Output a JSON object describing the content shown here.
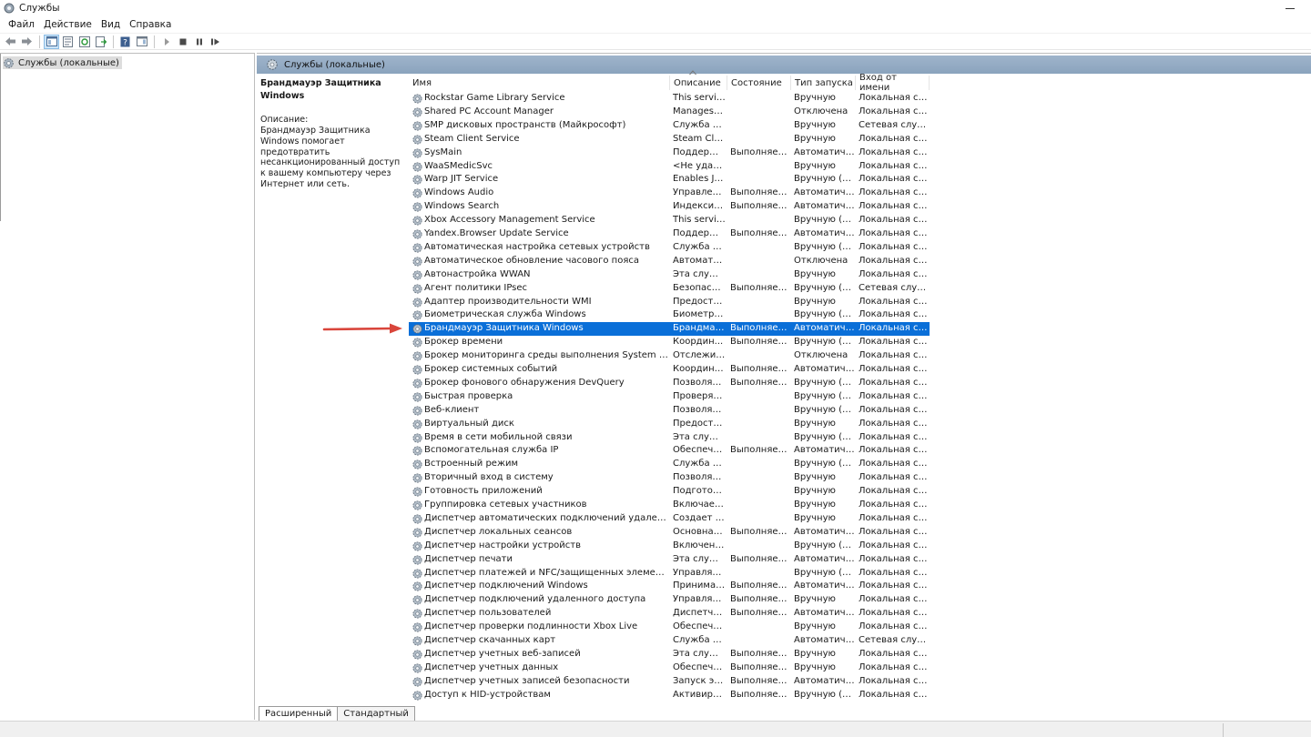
{
  "window": {
    "title": "Службы"
  },
  "menu": [
    "Файл",
    "Действие",
    "Вид",
    "Справка"
  ],
  "tree": {
    "root": "Службы (локальные)"
  },
  "pane": {
    "header": "Службы (локальные)"
  },
  "description": {
    "title": "Брандмауэр Защитника Windows",
    "caption": "Описание:",
    "text": "Брандмауэр Защитника Windows помогает предотвратить несанкционированный доступ к вашему компьютеру через Интернет или сеть."
  },
  "columns": [
    "Имя",
    "Описание",
    "Состояние",
    "Тип запуска",
    "Вход от имени"
  ],
  "selected_index": 17,
  "rows": [
    [
      "Rockstar Game Library Service",
      "This servic...",
      "",
      "Вручную",
      "Локальная сис..."
    ],
    [
      "Shared PC Account Manager",
      "Manages p...",
      "",
      "Отключена",
      "Локальная сис..."
    ],
    [
      "SMP дисковых пространств (Майкрософт)",
      "Служба уз...",
      "",
      "Вручную",
      "Сетевая служба"
    ],
    [
      "Steam Client Service",
      "Steam Clie...",
      "",
      "Вручную",
      "Локальная сис..."
    ],
    [
      "SysMain",
      "Поддержи...",
      "Выполняется",
      "Автоматиче...",
      "Локальная сис..."
    ],
    [
      "WaaSMedicSvc",
      "<Не удает...",
      "",
      "Вручную",
      "Локальная сис..."
    ],
    [
      "Warp JIT Service",
      "Enables JIT ...",
      "",
      "Вручную (ак...",
      "Локальная слу..."
    ],
    [
      "Windows Audio",
      "Управлен...",
      "Выполняется",
      "Автоматиче...",
      "Локальная слу..."
    ],
    [
      "Windows Search",
      "Индексир...",
      "Выполняется",
      "Автоматиче...",
      "Локальная сис..."
    ],
    [
      "Xbox Accessory Management Service",
      "This servic...",
      "",
      "Вручную (ак...",
      "Локальная сис..."
    ],
    [
      "Yandex.Browser Update Service",
      "Поддержи...",
      "Выполняется",
      "Автоматиче...",
      "Локальная сис..."
    ],
    [
      "Автоматическая настройка сетевых устройств",
      "Служба ав...",
      "",
      "Вручную (ак...",
      "Локальная слу..."
    ],
    [
      "Автоматическое обновление часового пояса",
      "Автомати...",
      "",
      "Отключена",
      "Локальная слу..."
    ],
    [
      "Автонастройка WWAN",
      "Эта служб...",
      "",
      "Вручную",
      "Локальная сис..."
    ],
    [
      "Агент политики IPsec",
      "Безопасно...",
      "Выполняется",
      "Вручную (ак...",
      "Сетевая служба"
    ],
    [
      "Адаптер производительности WMI",
      "Предостав...",
      "",
      "Вручную",
      "Локальная сис..."
    ],
    [
      "Биометрическая служба Windows",
      "Биометри...",
      "",
      "Вручную (ак...",
      "Локальная сис..."
    ],
    [
      "Брандмауэр Защитника Windows",
      "Брандмау...",
      "Выполняется",
      "Автоматиче...",
      "Локальная слу..."
    ],
    [
      "Брокер времени",
      "Координ...",
      "Выполняется",
      "Вручную (ак...",
      "Локальная слу..."
    ],
    [
      "Брокер мониторинга среды выполнения System Guard",
      "Отслежив...",
      "",
      "Отключена",
      "Локальная сис..."
    ],
    [
      "Брокер системных событий",
      "Координи...",
      "Выполняется",
      "Автоматиче...",
      "Локальная сис..."
    ],
    [
      "Брокер фонового обнаружения DevQuery",
      "Позволяет...",
      "Выполняется",
      "Вручную (ак...",
      "Локальная сис..."
    ],
    [
      "Быстрая проверка",
      "Проверяет...",
      "",
      "Вручную (ак...",
      "Локальная сис..."
    ],
    [
      "Веб-клиент",
      "Позволяет...",
      "",
      "Вручную (ак...",
      "Локальная слу..."
    ],
    [
      "Виртуальный диск",
      "Предостав...",
      "",
      "Вручную",
      "Локальная сис..."
    ],
    [
      "Время в сети мобильной связи",
      "Эта служб...",
      "",
      "Вручную (ак...",
      "Локальная слу..."
    ],
    [
      "Вспомогательная служба IP",
      "Обеспечи...",
      "Выполняется",
      "Автоматиче...",
      "Локальная сис..."
    ],
    [
      "Встроенный режим",
      "Служба \"В...",
      "",
      "Вручную (ак...",
      "Локальная сис..."
    ],
    [
      "Вторичный вход в систему",
      "Позволяет...",
      "",
      "Вручную",
      "Локальная сис..."
    ],
    [
      "Готовность приложений",
      "Подготови...",
      "",
      "Вручную",
      "Локальная сис..."
    ],
    [
      "Группировка сетевых участников",
      "Включает ...",
      "",
      "Вручную",
      "Локальная слу..."
    ],
    [
      "Диспетчер автоматических подключений удаленного досту...",
      "Создает п...",
      "",
      "Вручную",
      "Локальная сис..."
    ],
    [
      "Диспетчер локальных сеансов",
      "Основная ...",
      "Выполняется",
      "Автоматиче...",
      "Локальная сис..."
    ],
    [
      "Диспетчер настройки устройств",
      "Включени...",
      "",
      "Вручную (ак...",
      "Локальная сис..."
    ],
    [
      "Диспетчер печати",
      "Эта служб...",
      "Выполняется",
      "Автоматиче...",
      "Локальная сис..."
    ],
    [
      "Диспетчер платежей и NFC/защищенных элементов",
      "Управляет...",
      "",
      "Вручную (ак...",
      "Локальная слу..."
    ],
    [
      "Диспетчер подключений Windows",
      "Принимае...",
      "Выполняется",
      "Автоматиче...",
      "Локальная слу..."
    ],
    [
      "Диспетчер подключений удаленного доступа",
      "Управляет...",
      "Выполняется",
      "Вручную",
      "Локальная сис..."
    ],
    [
      "Диспетчер пользователей",
      "Диспетчер...",
      "Выполняется",
      "Автоматиче...",
      "Локальная сис..."
    ],
    [
      "Диспетчер проверки подлинности Xbox Live",
      "Обеспечи...",
      "",
      "Вручную",
      "Локальная сис..."
    ],
    [
      "Диспетчер скачанных карт",
      "Служба W...",
      "",
      "Автоматиче...",
      "Сетевая служба"
    ],
    [
      "Диспетчер учетных веб-записей",
      "Эта служб...",
      "Выполняется",
      "Вручную",
      "Локальная сис..."
    ],
    [
      "Диспетчер учетных данных",
      "Обеспечи...",
      "Выполняется",
      "Вручную",
      "Локальная сис..."
    ],
    [
      "Диспетчер учетных записей безопасности",
      "Запуск это...",
      "Выполняется",
      "Автоматиче...",
      "Локальная сис..."
    ],
    [
      "Доступ к HID-устройствам",
      "Активируе...",
      "Выполняется",
      "Вручную (ак...",
      "Локальная сис..."
    ]
  ],
  "tabs": [
    "Расширенный",
    "Стандартный"
  ],
  "icons": {
    "gear": "gear-icon",
    "back": "back-arrow-icon",
    "forward": "forward-arrow-icon",
    "annotation": "red-arrow-icon"
  },
  "colors": {
    "selection": "#0a6fd8",
    "header": "#8aa3bd",
    "annotation": "#d9453b"
  }
}
